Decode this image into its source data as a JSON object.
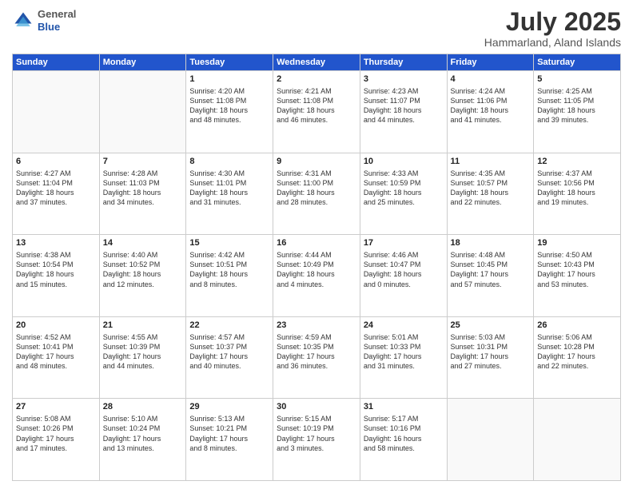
{
  "header": {
    "logo_general": "General",
    "logo_blue": "Blue",
    "month_title": "July 2025",
    "location": "Hammarland, Aland Islands"
  },
  "weekdays": [
    "Sunday",
    "Monday",
    "Tuesday",
    "Wednesday",
    "Thursday",
    "Friday",
    "Saturday"
  ],
  "weeks": [
    [
      {
        "day": "",
        "info": ""
      },
      {
        "day": "",
        "info": ""
      },
      {
        "day": "1",
        "info": "Sunrise: 4:20 AM\nSunset: 11:08 PM\nDaylight: 18 hours\nand 48 minutes."
      },
      {
        "day": "2",
        "info": "Sunrise: 4:21 AM\nSunset: 11:08 PM\nDaylight: 18 hours\nand 46 minutes."
      },
      {
        "day": "3",
        "info": "Sunrise: 4:23 AM\nSunset: 11:07 PM\nDaylight: 18 hours\nand 44 minutes."
      },
      {
        "day": "4",
        "info": "Sunrise: 4:24 AM\nSunset: 11:06 PM\nDaylight: 18 hours\nand 41 minutes."
      },
      {
        "day": "5",
        "info": "Sunrise: 4:25 AM\nSunset: 11:05 PM\nDaylight: 18 hours\nand 39 minutes."
      }
    ],
    [
      {
        "day": "6",
        "info": "Sunrise: 4:27 AM\nSunset: 11:04 PM\nDaylight: 18 hours\nand 37 minutes."
      },
      {
        "day": "7",
        "info": "Sunrise: 4:28 AM\nSunset: 11:03 PM\nDaylight: 18 hours\nand 34 minutes."
      },
      {
        "day": "8",
        "info": "Sunrise: 4:30 AM\nSunset: 11:01 PM\nDaylight: 18 hours\nand 31 minutes."
      },
      {
        "day": "9",
        "info": "Sunrise: 4:31 AM\nSunset: 11:00 PM\nDaylight: 18 hours\nand 28 minutes."
      },
      {
        "day": "10",
        "info": "Sunrise: 4:33 AM\nSunset: 10:59 PM\nDaylight: 18 hours\nand 25 minutes."
      },
      {
        "day": "11",
        "info": "Sunrise: 4:35 AM\nSunset: 10:57 PM\nDaylight: 18 hours\nand 22 minutes."
      },
      {
        "day": "12",
        "info": "Sunrise: 4:37 AM\nSunset: 10:56 PM\nDaylight: 18 hours\nand 19 minutes."
      }
    ],
    [
      {
        "day": "13",
        "info": "Sunrise: 4:38 AM\nSunset: 10:54 PM\nDaylight: 18 hours\nand 15 minutes."
      },
      {
        "day": "14",
        "info": "Sunrise: 4:40 AM\nSunset: 10:52 PM\nDaylight: 18 hours\nand 12 minutes."
      },
      {
        "day": "15",
        "info": "Sunrise: 4:42 AM\nSunset: 10:51 PM\nDaylight: 18 hours\nand 8 minutes."
      },
      {
        "day": "16",
        "info": "Sunrise: 4:44 AM\nSunset: 10:49 PM\nDaylight: 18 hours\nand 4 minutes."
      },
      {
        "day": "17",
        "info": "Sunrise: 4:46 AM\nSunset: 10:47 PM\nDaylight: 18 hours\nand 0 minutes."
      },
      {
        "day": "18",
        "info": "Sunrise: 4:48 AM\nSunset: 10:45 PM\nDaylight: 17 hours\nand 57 minutes."
      },
      {
        "day": "19",
        "info": "Sunrise: 4:50 AM\nSunset: 10:43 PM\nDaylight: 17 hours\nand 53 minutes."
      }
    ],
    [
      {
        "day": "20",
        "info": "Sunrise: 4:52 AM\nSunset: 10:41 PM\nDaylight: 17 hours\nand 48 minutes."
      },
      {
        "day": "21",
        "info": "Sunrise: 4:55 AM\nSunset: 10:39 PM\nDaylight: 17 hours\nand 44 minutes."
      },
      {
        "day": "22",
        "info": "Sunrise: 4:57 AM\nSunset: 10:37 PM\nDaylight: 17 hours\nand 40 minutes."
      },
      {
        "day": "23",
        "info": "Sunrise: 4:59 AM\nSunset: 10:35 PM\nDaylight: 17 hours\nand 36 minutes."
      },
      {
        "day": "24",
        "info": "Sunrise: 5:01 AM\nSunset: 10:33 PM\nDaylight: 17 hours\nand 31 minutes."
      },
      {
        "day": "25",
        "info": "Sunrise: 5:03 AM\nSunset: 10:31 PM\nDaylight: 17 hours\nand 27 minutes."
      },
      {
        "day": "26",
        "info": "Sunrise: 5:06 AM\nSunset: 10:28 PM\nDaylight: 17 hours\nand 22 minutes."
      }
    ],
    [
      {
        "day": "27",
        "info": "Sunrise: 5:08 AM\nSunset: 10:26 PM\nDaylight: 17 hours\nand 17 minutes."
      },
      {
        "day": "28",
        "info": "Sunrise: 5:10 AM\nSunset: 10:24 PM\nDaylight: 17 hours\nand 13 minutes."
      },
      {
        "day": "29",
        "info": "Sunrise: 5:13 AM\nSunset: 10:21 PM\nDaylight: 17 hours\nand 8 minutes."
      },
      {
        "day": "30",
        "info": "Sunrise: 5:15 AM\nSunset: 10:19 PM\nDaylight: 17 hours\nand 3 minutes."
      },
      {
        "day": "31",
        "info": "Sunrise: 5:17 AM\nSunset: 10:16 PM\nDaylight: 16 hours\nand 58 minutes."
      },
      {
        "day": "",
        "info": ""
      },
      {
        "day": "",
        "info": ""
      }
    ]
  ]
}
